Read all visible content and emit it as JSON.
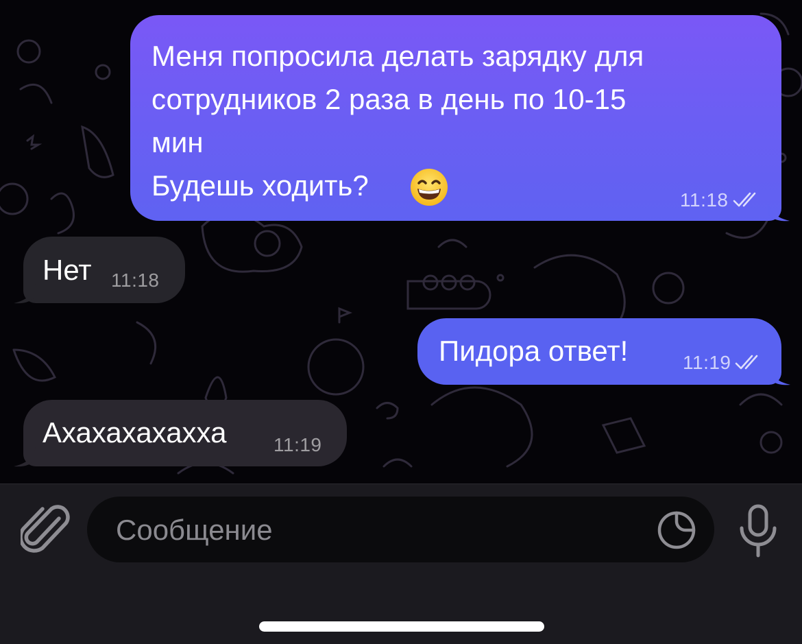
{
  "messages": [
    {
      "direction": "outgoing",
      "text": "Меня попросила делать зарядку для\nсотрудников 2 раза в день по 10-15\nмин\nБудешь ходить?",
      "emoji": "grinning-face-with-smiling-eyes",
      "time": "11:18",
      "status": "read"
    },
    {
      "direction": "incoming",
      "text": "Нет",
      "time": "11:18"
    },
    {
      "direction": "outgoing",
      "text": "Пидора ответ!",
      "time": "11:19",
      "status": "read"
    },
    {
      "direction": "incoming",
      "text": "Ахахахахахха",
      "time": "11:19"
    }
  ],
  "composer": {
    "placeholder": "Сообщение",
    "value": "",
    "attach_icon": "paperclip-icon",
    "sticker_icon": "sticker-icon",
    "mic_icon": "microphone-icon"
  },
  "colors": {
    "background": "#000000",
    "outgoing_bubble_top": "#7a58f6",
    "outgoing_bubble_bottom": "#5f62f2",
    "incoming_bubble": "#26252b",
    "input_panel": "#1b1a1f",
    "input_field": "#0b0b0d",
    "placeholder": "#8b8a90"
  }
}
